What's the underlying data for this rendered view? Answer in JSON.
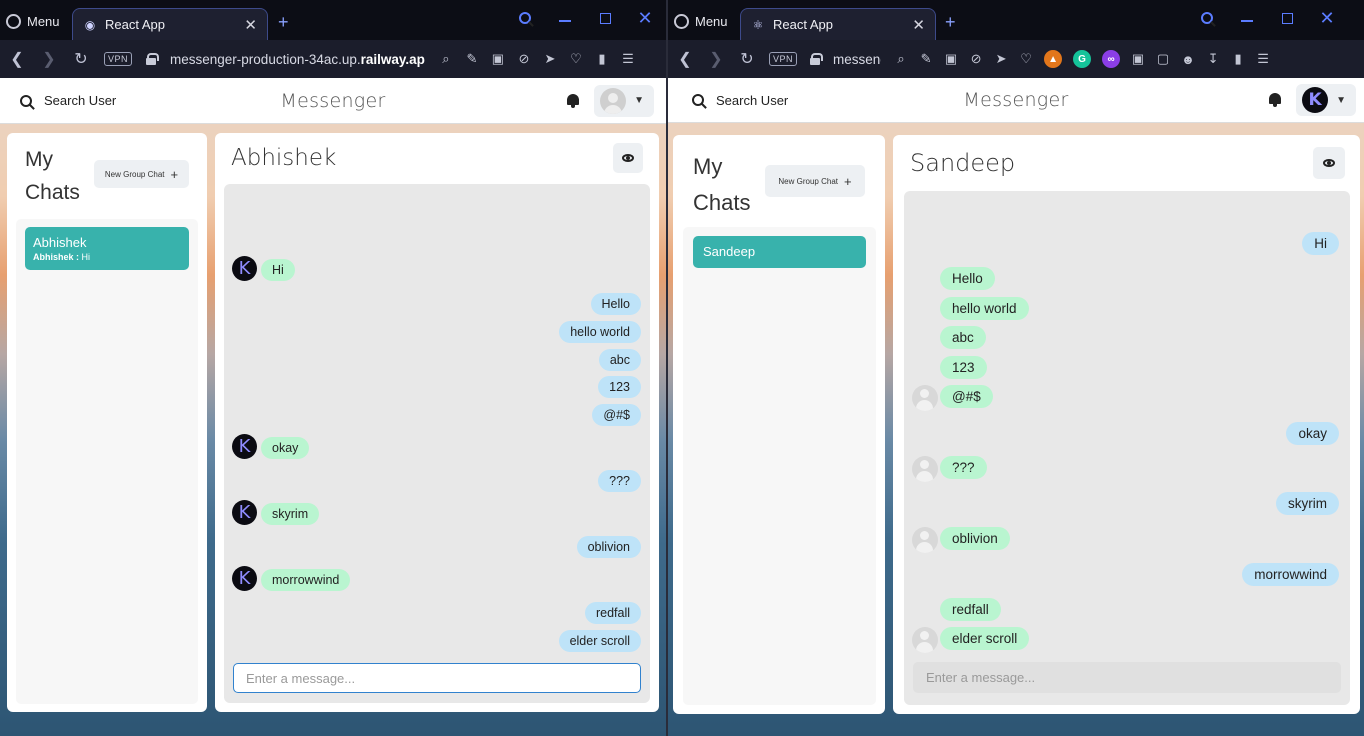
{
  "left_window": {
    "menu_label": "Menu",
    "tab_title": "React App",
    "url_prefix": "messenger-production-34ac.up.",
    "url_bold": "railway.ap",
    "vpn_label": "VPN",
    "app": {
      "search_label": "Search User",
      "brand": "Messenger",
      "my_chats_title": "My Chats",
      "new_group_label": "New Group Chat",
      "chat_item": {
        "name": "Abhishek",
        "latest_sender": "Abhishek :",
        "latest_text": " Hi"
      },
      "conversation_name": "Abhishek",
      "input_placeholder": "Enter a message...",
      "messages": [
        {
          "text": "Hi",
          "side": "them",
          "avatar": "K"
        },
        {
          "text": "Hello",
          "side": "me"
        },
        {
          "text": "hello world",
          "side": "me"
        },
        {
          "text": "abc",
          "side": "me"
        },
        {
          "text": "123",
          "side": "me"
        },
        {
          "text": "@#$",
          "side": "me"
        },
        {
          "text": "okay",
          "side": "them",
          "avatar": "K"
        },
        {
          "text": "???",
          "side": "me"
        },
        {
          "text": "skyrim",
          "side": "them",
          "avatar": "K"
        },
        {
          "text": "oblivion",
          "side": "me"
        },
        {
          "text": "morrowwind",
          "side": "them",
          "avatar": "K"
        },
        {
          "text": "redfall",
          "side": "me"
        },
        {
          "text": "elder scroll",
          "side": "me"
        }
      ]
    }
  },
  "right_window": {
    "menu_label": "Menu",
    "tab_title": "React App",
    "url_prefix": "messeng",
    "vpn_label": "VPN",
    "app": {
      "search_label": "Search User",
      "brand": "Messenger",
      "my_chats_title": "My Chats",
      "new_group_label": "New Group Chat",
      "chat_item": {
        "name": "Sandeep"
      },
      "conversation_name": "Sandeep",
      "input_placeholder": "Enter a message...",
      "profile_initial": "K",
      "messages": [
        {
          "text": "Hi",
          "side": "me"
        },
        {
          "text": "Hello",
          "side": "them"
        },
        {
          "text": "hello world",
          "side": "them"
        },
        {
          "text": "abc",
          "side": "them"
        },
        {
          "text": "123",
          "side": "them"
        },
        {
          "text": "@#$",
          "side": "them",
          "avatar": "blank"
        },
        {
          "text": "okay",
          "side": "me"
        },
        {
          "text": "???",
          "side": "them",
          "avatar": "blank"
        },
        {
          "text": "skyrim",
          "side": "me"
        },
        {
          "text": "oblivion",
          "side": "them",
          "avatar": "blank"
        },
        {
          "text": "morrowwind",
          "side": "me"
        },
        {
          "text": "redfall",
          "side": "them"
        },
        {
          "text": "elder scroll",
          "side": "them",
          "avatar": "blank"
        }
      ]
    }
  },
  "colors": {
    "chat_selected": "#38b2ac",
    "bubble_me": "#bee3f8",
    "bubble_them": "#b9f5d0",
    "browser_accent": "#5b7cff"
  }
}
